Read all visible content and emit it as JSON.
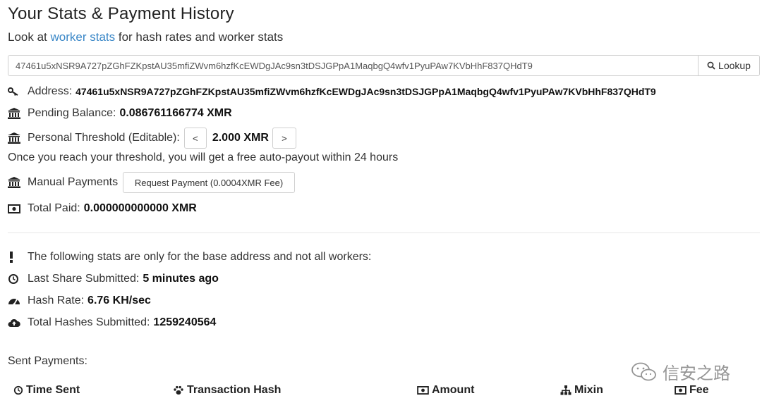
{
  "header": {
    "title": "Your Stats & Payment History",
    "subtitle_prefix": "Look at ",
    "subtitle_link": "worker stats",
    "subtitle_suffix": " for hash rates and worker stats"
  },
  "search": {
    "value": "47461u5xNSR9A727pZGhFZKpstAU35mfiZWvm6hzfKcEWDgJAc9sn3tDSJGPpA1MaqbgQ4wfv1PyuPAw7KVbHhF837QHdT9",
    "button_label": "Lookup",
    "button_icon": "search-icon"
  },
  "stats": {
    "address_label": "Address:",
    "address_value": "47461u5xNSR9A727pZGhFZKpstAU35mfiZWvm6hzfKcEWDgJAc9sn3tDSJGPpA1MaqbgQ4wfv1PyuPAw7KVbHhF837QHdT9",
    "pending_label": "Pending Balance:",
    "pending_value": "0.086761166774 XMR",
    "threshold_label": "Personal Threshold (Editable):",
    "threshold_dec": "<",
    "threshold_value": "2.000 XMR",
    "threshold_inc": ">",
    "threshold_note": "Once you reach your threshold, you will get a free auto-payout within 24 hours",
    "manual_label": "Manual Payments",
    "manual_button": "Request Payment (0.0004XMR Fee)",
    "total_paid_label": "Total Paid:",
    "total_paid_value": "0.000000000000 XMR"
  },
  "base_stats": {
    "notice": "The following stats are only for the base address and not all workers:",
    "last_share_label": "Last Share Submitted:",
    "last_share_value": "5 minutes ago",
    "hash_rate_label": "Hash Rate:",
    "hash_rate_value": "6.76 KH/sec",
    "total_hashes_label": "Total Hashes Submitted:",
    "total_hashes_value": "1259240564"
  },
  "payments": {
    "heading": "Sent Payments:",
    "columns": [
      "Time Sent",
      "Transaction Hash",
      "Amount",
      "Mixin",
      "Fee"
    ]
  },
  "watermark": {
    "text": "信安之路"
  },
  "colors": {
    "link": "#3a87c7",
    "text": "#333333",
    "border": "#cfcfcf"
  }
}
